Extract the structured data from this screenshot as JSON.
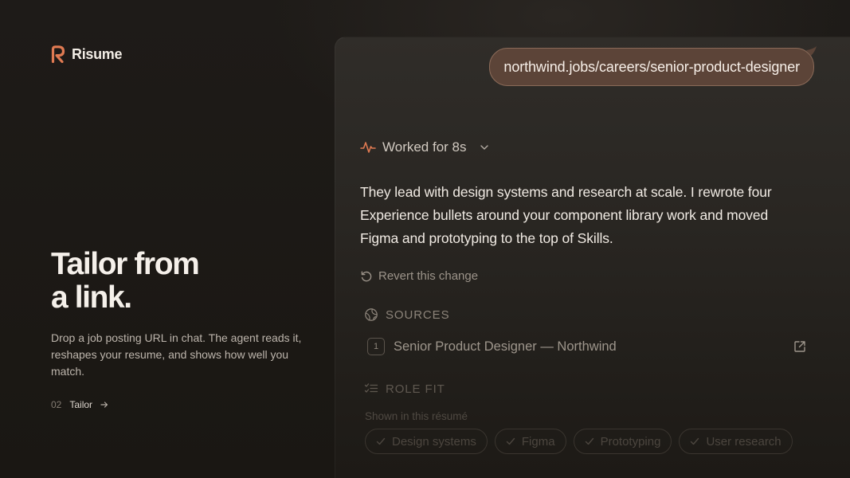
{
  "app": {
    "brand_name": "Risume",
    "accent_color": "#e07a52"
  },
  "hero": {
    "title_line1": "Tailor from",
    "title_line2": "a link.",
    "description": "Drop a job posting URL in chat. The agent reads it, reshapes your resume, and shows how well you match.",
    "step_number": "02",
    "step_label": "Tailor"
  },
  "chat": {
    "user_message": "northwind.jobs/careers/senior-product-designer",
    "status": "Worked for 8s",
    "assistant_message": "They lead with design systems and research at scale. I rewrote four Experience bullets around your component library work and moved Figma and prototyping to the top of Skills.",
    "revert_label": "Revert this change",
    "sources_header": "SOURCES",
    "sources": [
      {
        "index": "1",
        "title": "Senior Product Designer — Northwind"
      }
    ],
    "role_fit_header": "ROLE FIT",
    "shown_label": "Shown in this résumé",
    "tags": [
      "Design systems",
      "Figma",
      "Prototyping",
      "User research"
    ]
  }
}
